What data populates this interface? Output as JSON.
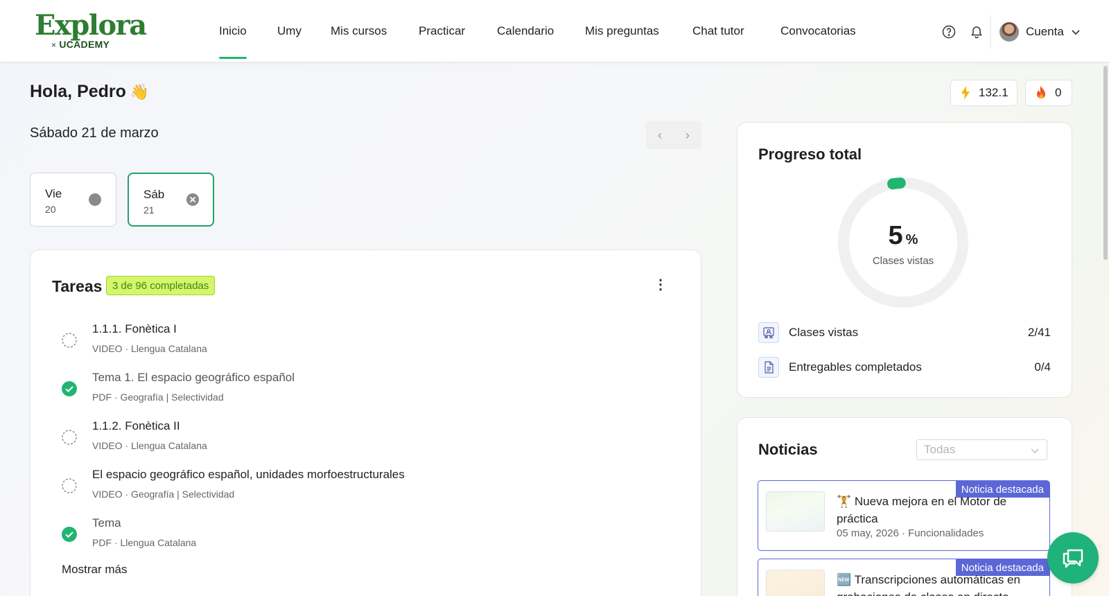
{
  "logo": {
    "main": "Explora",
    "sub_prefix": "×",
    "sub": "UCADEMY"
  },
  "nav": {
    "items": [
      {
        "label": "Inicio",
        "active": true
      },
      {
        "label": "Umy"
      },
      {
        "label": "Mis cursos"
      },
      {
        "label": "Practicar"
      },
      {
        "label": "Calendario"
      },
      {
        "label": "Mis preguntas"
      },
      {
        "label": "Chat tutor"
      },
      {
        "label": "Convocatorias"
      }
    ]
  },
  "header": {
    "help_icon": "help-circle-icon",
    "notifications_icon": "bell-icon",
    "account_label": "Cuenta"
  },
  "greeting": {
    "text": "Hola, Pedro",
    "emoji": "👋"
  },
  "stats": {
    "energy": "132.1",
    "streak": "0"
  },
  "day_view": {
    "date_label": "Sábado 21 de marzo"
  },
  "days": [
    {
      "name": "Vie",
      "num": "20",
      "selected": false
    },
    {
      "name": "Sáb",
      "num": "21",
      "selected": true
    }
  ],
  "tasks": {
    "title": "Tareas",
    "badge": "3 de 96 completadas",
    "items": [
      {
        "title": "1.1.1. Fonètica I",
        "subtitle": "VIDEO · Llengua Catalana",
        "done": false
      },
      {
        "title": "Tema 1. El espacio geográfico español",
        "subtitle": "PDF · Geografía | Selectividad",
        "done": true
      },
      {
        "title": "1.1.2. Fonètica II",
        "subtitle": "VIDEO · Llengua Catalana",
        "done": false
      },
      {
        "title": "El espacio geográfico español, unidades morfoestructurales",
        "subtitle": "VIDEO · Geografía | Selectividad",
        "done": false
      },
      {
        "title": "Tema",
        "subtitle": "PDF · Llengua Catalana",
        "done": true
      }
    ],
    "show_more": "Mostrar más"
  },
  "progress": {
    "title": "Progreso total",
    "percent": "5",
    "percent_symbol": "%",
    "percent_label": "Clases vistas",
    "rows": [
      {
        "label": "Clases vistas",
        "value": "2/41"
      },
      {
        "label": "Entregables completados",
        "value": "0/4"
      }
    ]
  },
  "news": {
    "title": "Noticias",
    "filter_placeholder": "Todas",
    "items": [
      {
        "flag": "Noticia destacada",
        "title": "🏋️ Nueva mejora en el Motor de práctica",
        "meta": "05 may, 2026 · Funcionalidades"
      },
      {
        "flag": "Noticia destacada",
        "title": "🆕 Transcripciones automáticas en grabaciones de clases en directo",
        "meta": ""
      }
    ]
  },
  "colors": {
    "accent": "#22b472",
    "badge_bg": "#d5f56b",
    "news_accent": "#5c67d6"
  }
}
